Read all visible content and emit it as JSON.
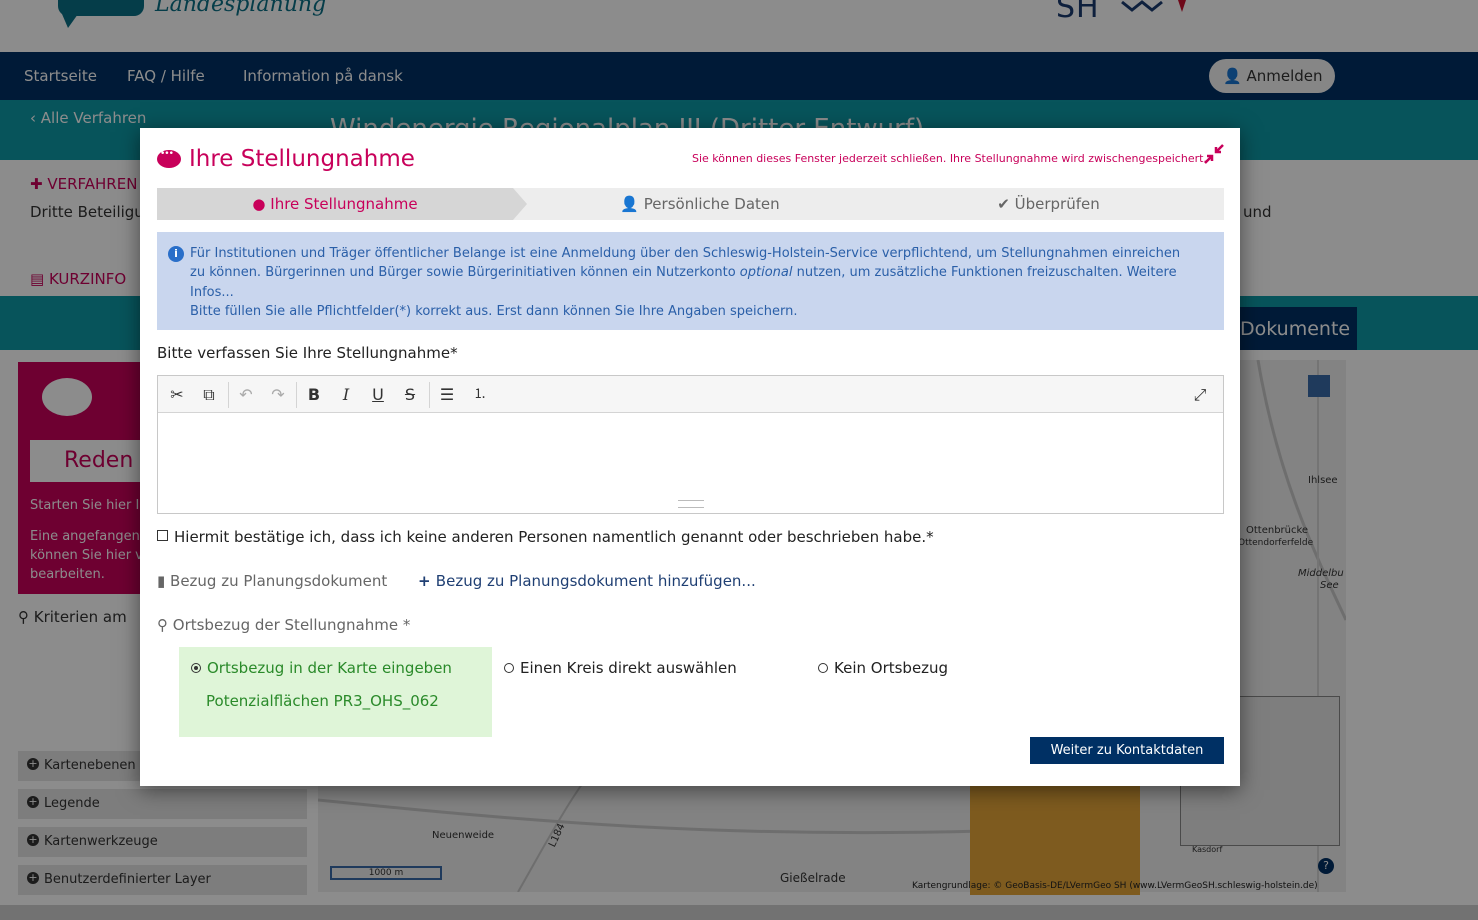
{
  "colors": {
    "navy": "#003064",
    "teal": "#0e9aa7",
    "accent": "#c8005a",
    "info_bg": "#c9d6ee",
    "info_text": "#2a5fa8",
    "selected_bg": "#dff5d8",
    "selected_text": "#2a8a2a"
  },
  "header": {
    "logo_text": "Landesplanung",
    "sh_logo": "SH"
  },
  "nav": {
    "items": [
      "Startseite",
      "FAQ / Hilfe",
      "Information på dansk"
    ],
    "login_label": "Anmelden"
  },
  "page": {
    "back_link": "Alle Verfahren",
    "title": "Windenergie Regionalplan III (Dritter Entwurf)",
    "verfahren_label": "VERFAHREN",
    "dritte_text": "Dritte Beteiligu",
    "und_text": "und",
    "kurzinfo_label": "KURZINFO",
    "dokumente_tab": "Dokumente",
    "reden_button": "Reden",
    "reden_text1": "Starten Sie hier I",
    "reden_text2": [
      "Eine angefangen",
      "können Sie hier v",
      "bearbeiten."
    ],
    "kriterien": "Kriterien am",
    "sidebar": [
      "Kartenebenen",
      "Legende",
      "Kartenwerkzeuge",
      "Benutzerdefinierter Layer"
    ],
    "map_places": [
      "Ihlsee",
      "Ottenbrücke",
      "Ottendorferfelde",
      "Middelbu",
      "See",
      "Neuenweide",
      "L184",
      "Gießelrade",
      "Kasdorf"
    ],
    "scale": "1000 m",
    "credit": "Kartengrundlage: © GeoBasis-DE/LVermGeo SH (www.LVermGeoSH.schleswig-holstein.de)"
  },
  "modal": {
    "title": "Ihre Stellungnahme",
    "close_note": "Sie können dieses Fenster jederzeit schließen. Ihre Stellungnahme wird zwischengespeichert.",
    "steps": [
      "Ihre Stellungnahme",
      "Persönliche Daten",
      "Überprüfen"
    ],
    "info_line1": "Für Institutionen und Träger öffentlicher Belange ist eine Anmeldung über den Schleswig-Holstein-Service verpflichtend, um Stellungnahmen einreichen",
    "info_line2_a": "zu können. Bürgerinnen und Bürger sowie Bürgerinitiativen können ein Nutzerkonto ",
    "info_line2_em": "optional",
    "info_line2_b": " nutzen, um zusätzliche Funktionen freizuschalten. Weitere",
    "info_line3": "Infos...",
    "info_line4": "Bitte füllen Sie alle Pflichtfelder(*) korrekt aus. Erst dann können Sie Ihre Angaben speichern.",
    "editor_label": "Bitte verfassen Sie Ihre Stellungnahme*",
    "editor_value": "",
    "toolbar_icons": [
      "cut-icon",
      "copy-icon",
      "undo-icon",
      "redo-icon",
      "bold-icon",
      "italic-icon",
      "underline-icon",
      "strikethrough-icon",
      "bulleted-list-icon",
      "numbered-list-icon",
      "maximize-icon"
    ],
    "confirm_text": "Hiermit bestätige ich, dass ich keine anderen Personen namentlich genannt oder beschrieben habe.*",
    "confirm_checked": false,
    "bezug_label": "Bezug zu Planungsdokument",
    "bezug_add": "Bezug zu Planungsdokument hinzufügen...",
    "orts_label": "Ortsbezug der Stellungnahme *",
    "radio_options": [
      "Ortsbezug in der Karte eingeben",
      "Einen Kreis direkt auswählen",
      "Kein Ortsbezug"
    ],
    "radio_selected": 0,
    "selected_area": "Potenzialflächen PR3_OHS_062",
    "next_button": "Weiter zu Kontaktdaten"
  }
}
